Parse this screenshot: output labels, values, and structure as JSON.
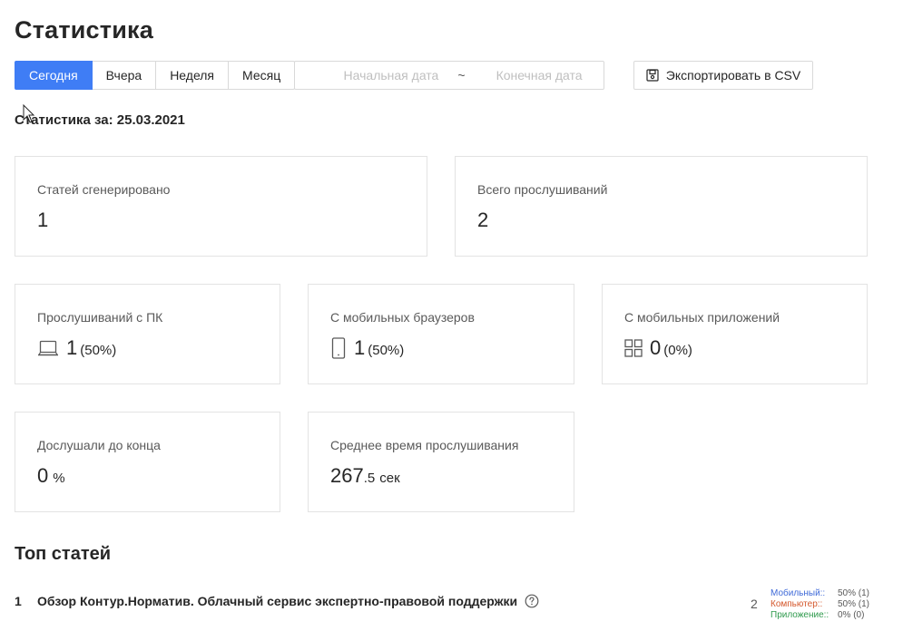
{
  "page": {
    "title": "Статистика"
  },
  "range": {
    "buttons": [
      "Сегодня",
      "Вчера",
      "Неделя",
      "Месяц"
    ],
    "active_index": 0,
    "start_placeholder": "Начальная дата",
    "separator": "~",
    "end_placeholder": "Конечная дата"
  },
  "export": {
    "label": "Экспортировать в CSV",
    "icon": "save-icon"
  },
  "stats_date": "Статистика за: 25.03.2021",
  "cards": {
    "generated": {
      "label": "Статей сгенерировано",
      "value": "1"
    },
    "total_listens": {
      "label": "Всего прослушиваний",
      "value": "2"
    },
    "pc": {
      "label": "Прослушиваний с ПК",
      "value": "1",
      "percent": "(50%)",
      "icon": "laptop-icon"
    },
    "mobile_browsers": {
      "label": "С мобильных браузеров",
      "value": "1",
      "percent": "(50%)",
      "icon": "mobile-phone-icon"
    },
    "mobile_apps": {
      "label": "С мобильных приложений",
      "value": "0",
      "percent": "(0%)",
      "icon": "apps-grid-icon"
    },
    "completed": {
      "label": "Дослушали до конца",
      "value": "0",
      "unit": "%"
    },
    "avg_time": {
      "label": "Среднее время прослушивания",
      "value_int": "267",
      "value_frac": ".5",
      "unit": "сек"
    }
  },
  "top": {
    "title": "Топ статей",
    "articles": [
      {
        "rank": "1",
        "title": "Обзор Контур.Норматив. Облачный сервис экспертно-правовой поддержки",
        "listens": "2",
        "breakdown": [
          {
            "label": "Мобильный::",
            "value": "50% (1)",
            "color": "#3f6ad8"
          },
          {
            "label": "Компьютер::",
            "value": "50% (1)",
            "color": "#d4572b"
          },
          {
            "label": "Приложение::",
            "value": "0% (0)",
            "color": "#2e9a4c"
          }
        ]
      }
    ]
  },
  "colors": {
    "accent": "#3f7df5",
    "border": "#e3e3e3"
  }
}
